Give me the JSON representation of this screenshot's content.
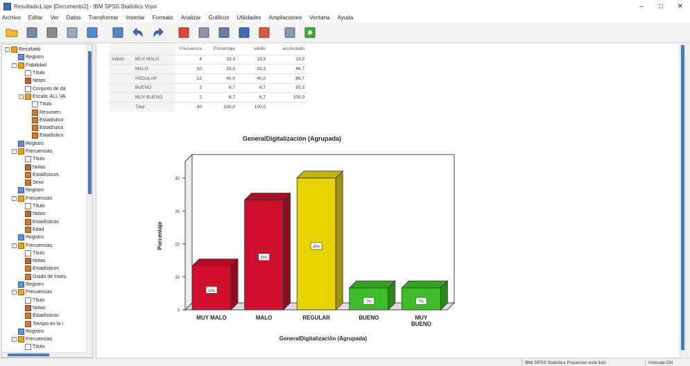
{
  "window": {
    "title": "Resultado1.spv [Documento2] - IBM SPSS Statistics Visor",
    "minimize": "–",
    "maximize": "□",
    "close": "✕"
  },
  "menu": [
    "Archivo",
    "Editar",
    "Ver",
    "Datos",
    "Transformar",
    "Insertar",
    "Formato",
    "Analizar",
    "Gráficos",
    "Utilidades",
    "Ampliaciones",
    "Ventana",
    "Ayuda"
  ],
  "toolbar": {
    "icons": [
      "open-folder-icon",
      "save-icon",
      "print-icon",
      "print-preview-icon",
      "export-icon",
      "recall-dialog-icon",
      "undo-icon",
      "redo-icon",
      "goto-data-icon",
      "goto-case-icon",
      "variables-icon",
      "pivot-icon",
      "show-all-icon",
      "designate-window-icon",
      "insert-icon"
    ]
  },
  "outline": [
    {
      "level": 0,
      "exp": "−",
      "icon": "folder",
      "label": "Resultado"
    },
    {
      "level": 1,
      "exp": "",
      "icon": "reg",
      "label": "Registro"
    },
    {
      "level": 1,
      "exp": "−",
      "icon": "folder",
      "label": "Fiabilidad"
    },
    {
      "level": 2,
      "exp": "",
      "icon": "title",
      "label": "Título"
    },
    {
      "level": 2,
      "exp": "",
      "icon": "note",
      "label": "Notas"
    },
    {
      "level": 2,
      "exp": "",
      "icon": "title",
      "label": "Conjunto de da"
    },
    {
      "level": 2,
      "exp": "−",
      "icon": "folder",
      "label": "Escala: ALL VA"
    },
    {
      "level": 3,
      "exp": "",
      "icon": "title",
      "label": "Título"
    },
    {
      "level": 3,
      "exp": "",
      "icon": "table",
      "label": "Resumen"
    },
    {
      "level": 3,
      "exp": "",
      "icon": "table",
      "label": "Estadístico"
    },
    {
      "level": 3,
      "exp": "",
      "icon": "table",
      "label": "Estadístico"
    },
    {
      "level": 3,
      "exp": "",
      "icon": "table",
      "label": "Estadístico"
    },
    {
      "level": 1,
      "exp": "",
      "icon": "reg",
      "label": "Registro"
    },
    {
      "level": 1,
      "exp": "−",
      "icon": "folder",
      "label": "Frecuencias"
    },
    {
      "level": 2,
      "exp": "",
      "icon": "title",
      "label": "Título"
    },
    {
      "level": 2,
      "exp": "",
      "icon": "note",
      "label": "Notas"
    },
    {
      "level": 2,
      "exp": "",
      "icon": "table",
      "label": "Estadísticos"
    },
    {
      "level": 2,
      "exp": "",
      "icon": "table",
      "label": "Sexo"
    },
    {
      "level": 1,
      "exp": "",
      "icon": "reg",
      "label": "Registro"
    },
    {
      "level": 1,
      "exp": "−",
      "icon": "folder",
      "label": "Frecuencias"
    },
    {
      "level": 2,
      "exp": "",
      "icon": "title",
      "label": "Título"
    },
    {
      "level": 2,
      "exp": "",
      "icon": "note",
      "label": "Notas"
    },
    {
      "level": 2,
      "exp": "",
      "icon": "table",
      "label": "Estadísticos"
    },
    {
      "level": 2,
      "exp": "",
      "icon": "table",
      "label": "Edad"
    },
    {
      "level": 1,
      "exp": "",
      "icon": "reg",
      "label": "Registro"
    },
    {
      "level": 1,
      "exp": "−",
      "icon": "folder",
      "label": "Frecuencias"
    },
    {
      "level": 2,
      "exp": "",
      "icon": "title",
      "label": "Título"
    },
    {
      "level": 2,
      "exp": "",
      "icon": "note",
      "label": "Notas"
    },
    {
      "level": 2,
      "exp": "",
      "icon": "table",
      "label": "Estadísticos"
    },
    {
      "level": 2,
      "exp": "",
      "icon": "table",
      "label": "Grado de Instru"
    },
    {
      "level": 1,
      "exp": "",
      "icon": "reg",
      "label": "Registro"
    },
    {
      "level": 1,
      "exp": "−",
      "icon": "folder",
      "label": "Frecuencias"
    },
    {
      "level": 2,
      "exp": "",
      "icon": "title",
      "label": "Título"
    },
    {
      "level": 2,
      "exp": "",
      "icon": "note",
      "label": "Notas"
    },
    {
      "level": 2,
      "exp": "",
      "icon": "table",
      "label": "Estadísticos"
    },
    {
      "level": 2,
      "exp": "",
      "icon": "table",
      "label": "Tiempo en la I"
    },
    {
      "level": 1,
      "exp": "",
      "icon": "reg",
      "label": "Registro"
    },
    {
      "level": 1,
      "exp": "−",
      "icon": "folder",
      "label": "Frecuencias"
    },
    {
      "level": 2,
      "exp": "",
      "icon": "title",
      "label": "Título"
    },
    {
      "level": 2,
      "exp": "",
      "icon": "note",
      "label": "Notas"
    }
  ],
  "freq_table": {
    "headers": [
      "",
      "",
      "Frecuencia",
      "Porcentaje",
      "válido",
      "acumulado"
    ],
    "group_label": "Válido",
    "rows": [
      {
        "cat": "MUY MALO",
        "freq": "4",
        "pct": "13,3",
        "valid": "13,3",
        "cum": "13,3"
      },
      {
        "cat": "MALO",
        "freq": "10",
        "pct": "33,3",
        "valid": "33,3",
        "cum": "46,7"
      },
      {
        "cat": "REGULAR",
        "freq": "12",
        "pct": "40,0",
        "valid": "40,0",
        "cum": "86,7"
      },
      {
        "cat": "BUENO",
        "freq": "2",
        "pct": "6,7",
        "valid": "6,7",
        "cum": "93,3"
      },
      {
        "cat": "MUY BUENO",
        "freq": "2",
        "pct": "6,7",
        "valid": "6,7",
        "cum": "100,0"
      },
      {
        "cat": "Total",
        "freq": "30",
        "pct": "100,0",
        "valid": "100,0",
        "cum": ""
      }
    ]
  },
  "chart_data": {
    "type": "bar",
    "title": "GeneralDigitalización (Agrupada)",
    "xlabel": "GeneralDigitalización (Agrupada)",
    "ylabel": "Porcentaje",
    "categories": [
      "MUY MALO",
      "MALO",
      "REGULAR",
      "BUENO",
      "MUY BUENO"
    ],
    "values": [
      13.33,
      33.33,
      40.0,
      6.67,
      6.67
    ],
    "data_labels": [
      "13%",
      "33%",
      "40%",
      "7%",
      "7%"
    ],
    "colors": [
      "#d0102a",
      "#d0102a",
      "#e6d300",
      "#3fbe2a",
      "#3fbe2a"
    ],
    "ylim": [
      0,
      45
    ],
    "yticks": [
      0,
      10,
      20,
      30,
      40
    ],
    "grid": false,
    "legend": "none",
    "style": "3d"
  },
  "status": {
    "processor": "IBM SPSS Statistics Processor está listo",
    "unicode": "Unicode:ON"
  }
}
